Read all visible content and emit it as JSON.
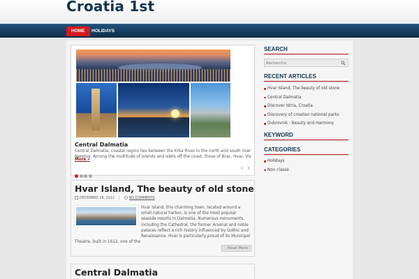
{
  "site": {
    "title": "Croatia 1st"
  },
  "nav": {
    "items": [
      "HOME",
      "HOLIDAYS"
    ]
  },
  "slider": {
    "title": "Central Dalmatia",
    "text": "Central Dalmatia, coastal region lies between the Krka River in the north and south river Neretva. Among the multitude of islands and islets off the coast, those of Brac, Hvar, Vis and",
    "more": "More »",
    "dot_count": 4,
    "active_dot": 1
  },
  "post1": {
    "title": "Hvar Island, The beauty of old stone",
    "date": "DÉCEMBRE 28, 2012",
    "comments": "NO COMMENTS",
    "excerpt": "Hvar Island, this charming town, located around a small natural harbor, is one of the most popular seaside resorts in Dalmatia. Numerous monuments, including the Cathedral, the former Arsenal and noble palaces reflect a rich history influenced by Gothic and Renaissance. Hvar is particularly proud of its Municipal Theatre, built in 1612, one of the",
    "read_more": "Read More"
  },
  "post2": {
    "title": "Central Dalmatia"
  },
  "sidebar": {
    "search_title": "SEARCH",
    "search_placeholder": "Recherche",
    "recent_title": "RECENT ARTICLES",
    "recent": [
      "Hvar Island, The beauty of old stone",
      "Central Dalmatia",
      "Discover Istria, Croatia",
      "Discovery of croatian national parks",
      "Dubrovnik : Beauty and Harmony"
    ],
    "keyword_title": "KEYWORD",
    "categories_title": "CATEGORIES",
    "categories": [
      "Holidays",
      "Non classé"
    ]
  },
  "colors": {
    "brand_navy": "#13344f",
    "accent_red": "#d41a1f"
  }
}
